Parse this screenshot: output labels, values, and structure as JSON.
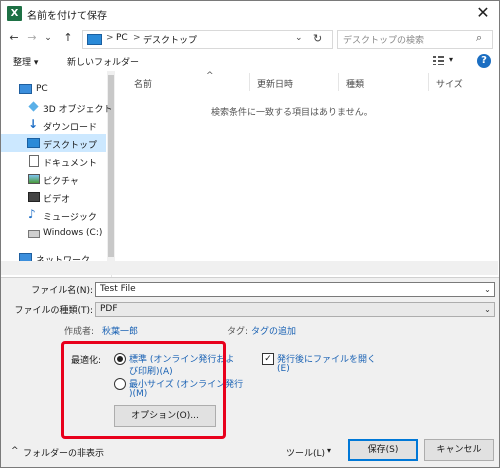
{
  "window": {
    "title": "名前を付けて保存",
    "close_glyph": "✕"
  },
  "nav": {
    "back": "←",
    "forward": "→",
    "recent": "⌄",
    "up": "↑",
    "breadcrumb": [
      "PC",
      "デスクトップ"
    ],
    "breadcrumb_sep": ">",
    "refresh": "↻",
    "search_placeholder": "デスクトップの検索",
    "search_icon": "⌕"
  },
  "toolbar": {
    "organize": "整理 ▾",
    "new_folder": "新しいフォルダー",
    "view": "▾",
    "help": "?"
  },
  "sidebar": {
    "items": [
      {
        "label": "PC",
        "icon": "pc-icon"
      },
      {
        "label": "3D オブジェクト",
        "icon": "cube-icon"
      },
      {
        "label": "ダウンロード",
        "icon": "download-arrow-icon"
      },
      {
        "label": "デスクトップ",
        "icon": "desktop-icon"
      },
      {
        "label": "ドキュメント",
        "icon": "document-icon"
      },
      {
        "label": "ピクチャ",
        "icon": "picture-icon"
      },
      {
        "label": "ビデオ",
        "icon": "video-icon"
      },
      {
        "label": "ミュージック",
        "icon": "music-note-icon"
      },
      {
        "label": "Windows (C:)",
        "icon": "drive-icon"
      },
      {
        "label": "ネットワーク",
        "icon": "network-icon"
      }
    ],
    "selected_index": 3
  },
  "columns": [
    "名前",
    "更新日時",
    "種類",
    "サイズ"
  ],
  "sort_glyph": "^",
  "empty_message": "検索条件に一致する項目はありません。",
  "form": {
    "filename_label": "ファイル名(N):",
    "filename_label_key": "N",
    "filename_value": "Test File",
    "filetype_label": "ファイルの種類(T):",
    "filetype_label_key": "T",
    "filetype_value": "PDF",
    "author_label": "作成者:",
    "author_value": "秋葉一郎",
    "tags_label": "タグ:",
    "tags_value": "タグの追加",
    "optimize_label": "最適化:",
    "option_standard_line1": "標準 (オンライン発行およ",
    "option_standard_line2": "び印刷)(A)",
    "option_min_line1": "最小サイズ (オンライン発行",
    "option_min_line2": ")(M)",
    "options_button": "オプション(O)...",
    "open_after_line1": "発行後にファイルを開く",
    "open_after_line2": "(E)",
    "open_after_checked": "✓"
  },
  "footer": {
    "hide_folders": "フォルダーの非表示",
    "hide_folders_glyph": "^",
    "tools": "ツール(L)",
    "tools_glyph": "▾",
    "save": "保存(S)",
    "cancel": "キャンセル"
  },
  "colors": {
    "accent": "#0078d7",
    "highlight_box": "#e8001c",
    "selected_bg": "#cce8ff",
    "link": "#1a62b4"
  }
}
